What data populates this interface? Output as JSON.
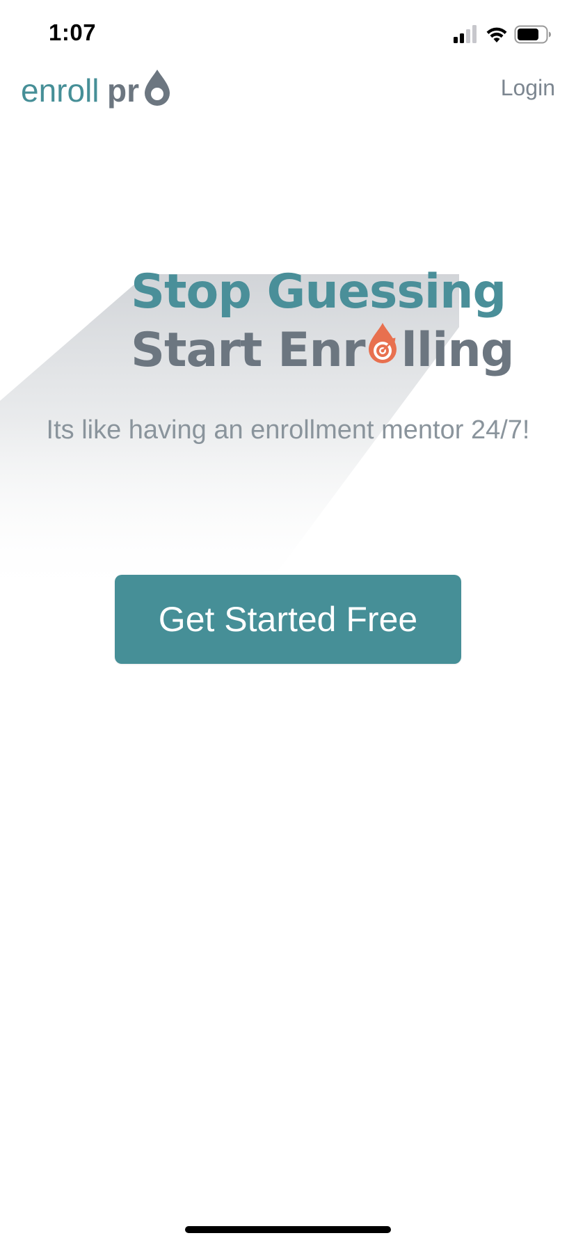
{
  "status_bar": {
    "time": "1:07",
    "icons": [
      "cellular-signal-icon",
      "wifi-icon",
      "battery-icon"
    ]
  },
  "header": {
    "logo_text_light": "enroll",
    "logo_text_bold": "pr",
    "login_label": "Login"
  },
  "hero": {
    "line1": "Stop Guessing",
    "line2_start": "Start Enr",
    "line2_end": "lling",
    "tagline": "Its like having an enrollment mentor 24/7!"
  },
  "cta": {
    "label": "Get Started Free"
  },
  "colors": {
    "brand_teal": "#468f97",
    "brand_gray": "#6c7680",
    "accent_orange": "#e8704f"
  }
}
